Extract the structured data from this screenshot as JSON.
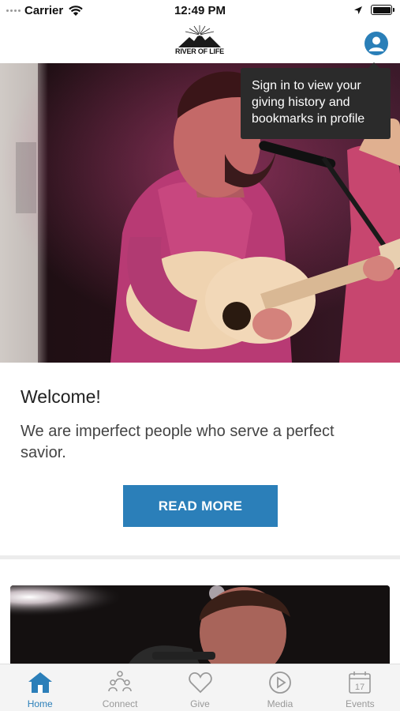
{
  "status_bar": {
    "carrier": "Carrier",
    "time": "12:49 PM"
  },
  "header": {
    "logo_text": "RIVER OF LIFE"
  },
  "tooltip": {
    "text": "Sign in to view your giving history and bookmarks in profile"
  },
  "welcome": {
    "title": "Welcome!",
    "text": "We are imperfect people who serve a perfect savior.",
    "button_label": "READ MORE"
  },
  "tabs": [
    {
      "label": "Home",
      "icon": "home-icon",
      "active": true
    },
    {
      "label": "Connect",
      "icon": "people-icon",
      "active": false
    },
    {
      "label": "Give",
      "icon": "heart-icon",
      "active": false
    },
    {
      "label": "Media",
      "icon": "play-icon",
      "active": false
    },
    {
      "label": "Events",
      "icon": "calendar-icon",
      "active": false
    }
  ],
  "events_icon_day": "17",
  "colors": {
    "accent": "#2b7fb9",
    "tooltip_bg": "#2b2b2b",
    "tab_inactive": "#999999"
  }
}
